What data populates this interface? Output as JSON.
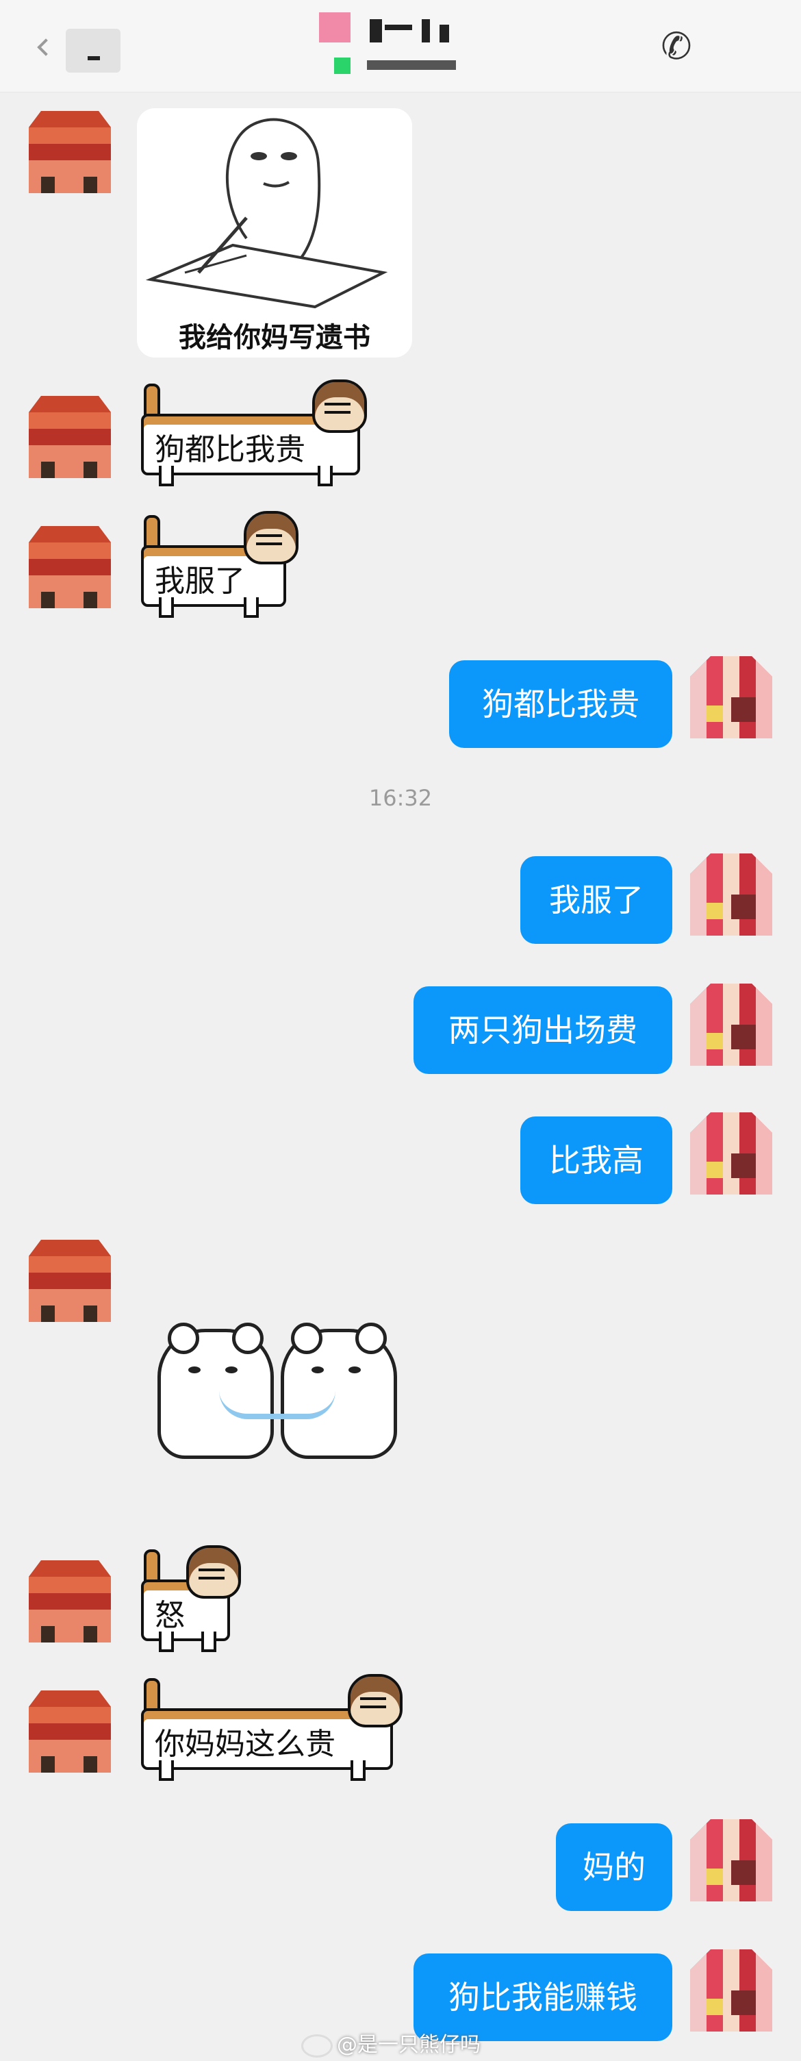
{
  "sticker_caption": "我给你妈写遗书",
  "timestamp": "16:32",
  "messages": [
    {
      "side": "left",
      "kind": "image"
    },
    {
      "side": "left",
      "kind": "dog-banner",
      "text": "狗都比我贵"
    },
    {
      "side": "left",
      "kind": "dog-banner",
      "text": "我服了"
    },
    {
      "side": "right",
      "kind": "text",
      "text": "狗都比我贵"
    },
    {
      "side": "right",
      "kind": "text",
      "text": "我服了"
    },
    {
      "side": "right",
      "kind": "text",
      "text": "两只狗出场费"
    },
    {
      "side": "right",
      "kind": "text",
      "text": "比我高"
    },
    {
      "side": "left",
      "kind": "bears-sticker"
    },
    {
      "side": "left",
      "kind": "dog-banner",
      "text": "怒"
    },
    {
      "side": "left",
      "kind": "dog-banner",
      "text": "你妈妈这么贵"
    },
    {
      "side": "right",
      "kind": "text",
      "text": "妈的"
    },
    {
      "side": "right",
      "kind": "text",
      "text": "狗比我能赚钱"
    }
  ],
  "watermark": "@是一只熊仔吗",
  "icons": {
    "back": "chevron-left-icon",
    "call": "phone-icon"
  },
  "colors": {
    "bubble": "#0c98fb",
    "background": "#f0f0f0"
  }
}
